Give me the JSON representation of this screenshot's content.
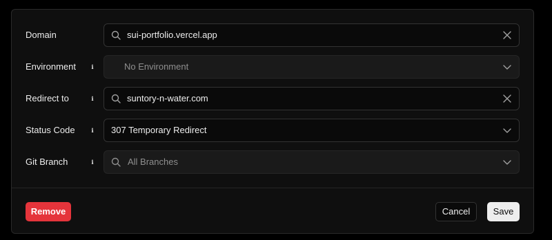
{
  "form": {
    "domain": {
      "label": "Domain",
      "value": "sui-portfolio.vercel.app",
      "icons": {
        "left": "search-icon",
        "right": "close-icon"
      }
    },
    "environment": {
      "label": "Environment",
      "value": "No Environment",
      "disabled": true,
      "icons": {
        "info": "info-icon",
        "right": "chevron-down-icon"
      }
    },
    "redirect": {
      "label": "Redirect to",
      "value": "suntory-n-water.com",
      "icons": {
        "info": "info-icon",
        "left": "search-icon",
        "right": "close-icon"
      }
    },
    "status": {
      "label": "Status Code",
      "value": "307 Temporary Redirect",
      "icons": {
        "info": "info-icon",
        "right": "chevron-down-icon"
      }
    },
    "branch": {
      "label": "Git Branch",
      "placeholder": "All Branches",
      "disabled": true,
      "icons": {
        "info": "info-icon",
        "left": "search-icon",
        "right": "chevron-down-icon"
      }
    }
  },
  "footer": {
    "remove_label": "Remove",
    "cancel_label": "Cancel",
    "save_label": "Save"
  },
  "colors": {
    "background": "#000000",
    "panel": "#0f0f0f",
    "danger": "#e5343b",
    "primary_button": "#ededed"
  }
}
